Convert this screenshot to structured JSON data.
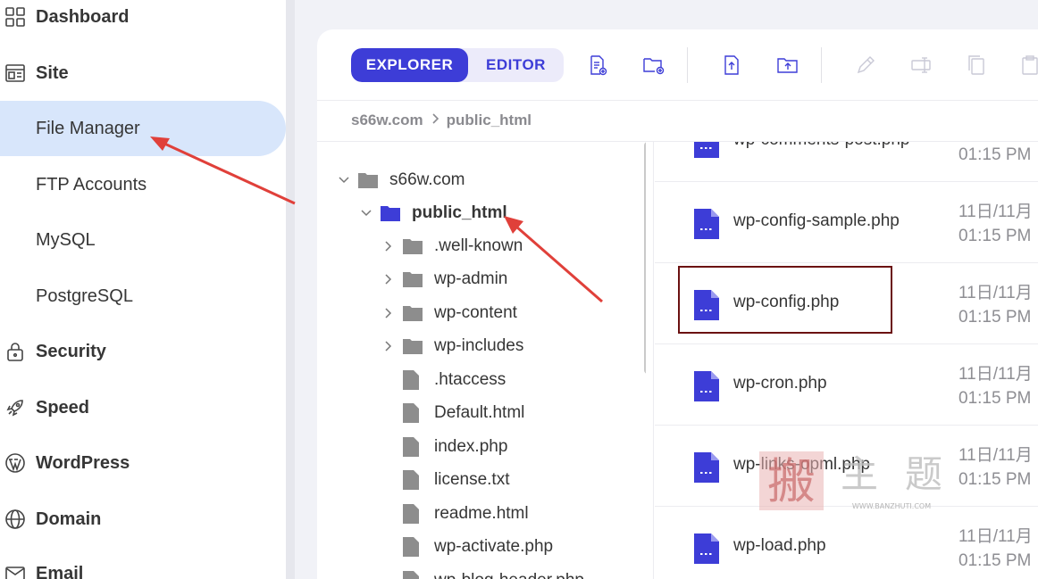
{
  "sidebar": {
    "items": [
      {
        "label": "Dashboard",
        "icon": "grid-icon",
        "kind": "section"
      },
      {
        "label": "Site",
        "icon": "site-icon",
        "kind": "section"
      },
      {
        "label": "File Manager",
        "kind": "sub",
        "active": true
      },
      {
        "label": "FTP Accounts",
        "kind": "sub"
      },
      {
        "label": "MySQL",
        "kind": "sub"
      },
      {
        "label": "PostgreSQL",
        "kind": "sub"
      },
      {
        "label": "Security",
        "icon": "lock-icon",
        "kind": "section"
      },
      {
        "label": "Speed",
        "icon": "rocket-icon",
        "kind": "section"
      },
      {
        "label": "WordPress",
        "icon": "wordpress-icon",
        "kind": "section"
      },
      {
        "label": "Domain",
        "icon": "globe-icon",
        "kind": "section"
      },
      {
        "label": "Email",
        "icon": "mail-icon",
        "kind": "section"
      }
    ]
  },
  "toolbar": {
    "explorer_label": "EXPLORER",
    "editor_label": "EDITOR",
    "icons": [
      "new-file-icon",
      "new-folder-icon",
      "upload-file-icon",
      "upload-folder-icon",
      "rename-pen-icon",
      "rename-field-icon",
      "copy-icon",
      "paste-icon"
    ]
  },
  "breadcrumb": {
    "root": "s66w.com",
    "current": "public_html"
  },
  "tree": {
    "root": "s66w.com",
    "folder": "public_html",
    "children": [
      {
        "name": ".well-known",
        "type": "folder"
      },
      {
        "name": "wp-admin",
        "type": "folder"
      },
      {
        "name": "wp-content",
        "type": "folder"
      },
      {
        "name": "wp-includes",
        "type": "folder"
      },
      {
        "name": ".htaccess",
        "type": "file"
      },
      {
        "name": "Default.html",
        "type": "file"
      },
      {
        "name": "index.php",
        "type": "file"
      },
      {
        "name": "license.txt",
        "type": "file"
      },
      {
        "name": "readme.html",
        "type": "file"
      },
      {
        "name": "wp-activate.php",
        "type": "file"
      },
      {
        "name": "wp-blog-header.php",
        "type": "file"
      }
    ]
  },
  "files": [
    {
      "name": "wp-comments-post.php",
      "date": "",
      "time": "01:15 PM"
    },
    {
      "name": "wp-config-sample.php",
      "date": "11日/11月",
      "time": "01:15 PM"
    },
    {
      "name": "wp-config.php",
      "date": "11日/11月",
      "time": "01:15 PM",
      "highlighted": true
    },
    {
      "name": "wp-cron.php",
      "date": "11日/11月",
      "time": "01:15 PM"
    },
    {
      "name": "wp-links-opml.php",
      "date": "11日/11月",
      "time": "01:15 PM"
    },
    {
      "name": "wp-load.php",
      "date": "11日/11月",
      "time": "01:15 PM"
    }
  ],
  "watermark": {
    "text": "搬主题",
    "url": "WWW.BANZHUTI.COM"
  },
  "colors": {
    "accent": "#3d3dd7",
    "active_bg": "#d8e6fb",
    "arrow": "#e0403a",
    "highlight_box": "#6b1111"
  }
}
